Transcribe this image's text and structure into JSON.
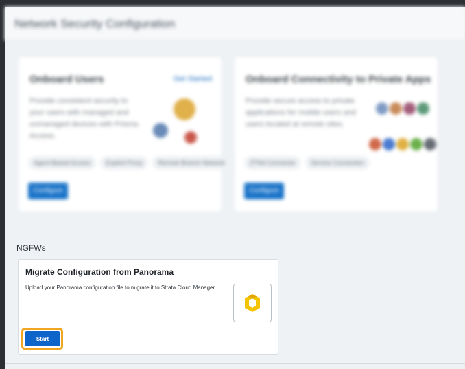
{
  "page": {
    "title": "Network Security Configuration"
  },
  "cards": [
    {
      "title": "Onboard Users",
      "link": "Get Started",
      "description": "Provide consistent security to your users with managed and unmanaged devices with Prisma Access.",
      "chips": [
        "Agent-Based Access",
        "Explicit Proxy",
        "Remote Branch Network"
      ],
      "button": "Configure"
    },
    {
      "title": "Onboard Connectivity to Private Apps",
      "description": "Provide secure access to private applications for mobile users and users located at remote sites.",
      "chips": [
        "ZTNA Connector",
        "Service Connection"
      ],
      "button": "Configure"
    }
  ],
  "ngfw_section": {
    "label": "NGFWs",
    "card": {
      "title": "Migrate Configuration from Panorama",
      "description": "Upload your Panorama configuration file to migrate it to Strata Cloud Manager.",
      "start_label": "Start",
      "logo_icon": "strata-logo-icon"
    }
  },
  "colors": {
    "accent": "#0d64c9",
    "highlight": "#f0a623",
    "logo_yellow": "#f5c400"
  }
}
